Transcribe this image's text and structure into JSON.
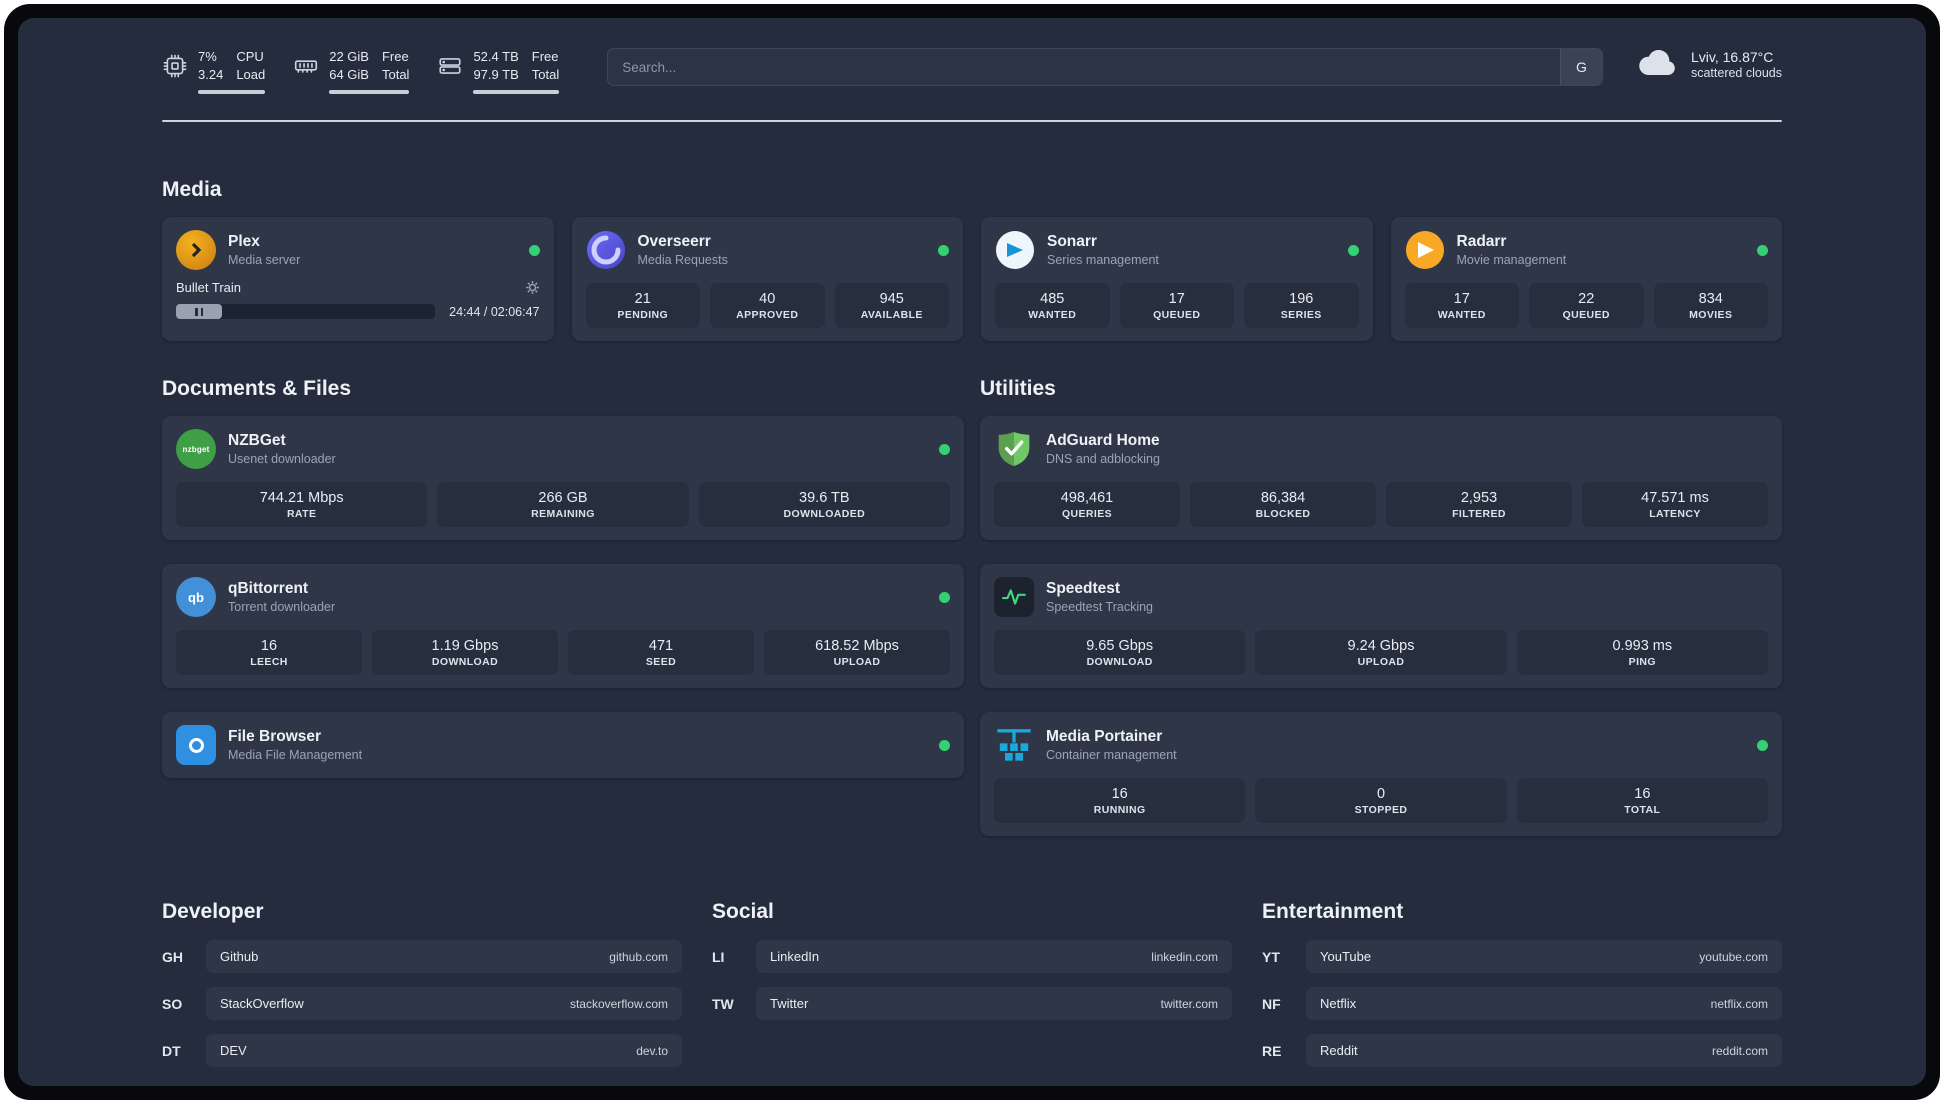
{
  "theme": {
    "background": "#242c3e",
    "card": "#2f3647",
    "stat_tile": "#272e3d",
    "status_online": "#35d073",
    "brand": {
      "plex": "#e5a00d",
      "overseerr": "#5f5cd6",
      "sonarr": "#1794d4",
      "radarr": "#f9a826",
      "nzbget": "#3f9f47",
      "qbittorrent": "#4291d8",
      "filebrowser": "#2f8fe0",
      "adguard": "#67b860",
      "speedtest": "#3fd97c",
      "portainer": "#1aa9dd"
    }
  },
  "topbar": {
    "cpu": {
      "value1": "7%",
      "value2": "3.24",
      "label1": "CPU",
      "label2": "Load"
    },
    "ram": {
      "value1": "22 GiB",
      "value2": "64 GiB",
      "label1": "Free",
      "label2": "Total"
    },
    "disk": {
      "value1": "52.4 TB",
      "value2": "97.9 TB",
      "label1": "Free",
      "label2": "Total"
    },
    "search": {
      "placeholder": "Search...",
      "button_label": "G"
    },
    "weather": {
      "location": "Lviv, 16.87°C",
      "condition": "scattered clouds"
    }
  },
  "sections": {
    "media": "Media",
    "documents": "Documents & Files",
    "utilities": "Utilities",
    "developer": "Developer",
    "social": "Social",
    "entertainment": "Entertainment"
  },
  "apps": {
    "plex": {
      "name": "Plex",
      "desc": "Media server",
      "now_playing": "Bullet Train",
      "time": "24:44 / 02:06:47"
    },
    "overseerr": {
      "name": "Overseerr",
      "desc": "Media Requests",
      "stats": [
        {
          "value": "21",
          "label": "PENDING"
        },
        {
          "value": "40",
          "label": "APPROVED"
        },
        {
          "value": "945",
          "label": "AVAILABLE"
        }
      ]
    },
    "sonarr": {
      "name": "Sonarr",
      "desc": "Series management",
      "stats": [
        {
          "value": "485",
          "label": "WANTED"
        },
        {
          "value": "17",
          "label": "QUEUED"
        },
        {
          "value": "196",
          "label": "SERIES"
        }
      ]
    },
    "radarr": {
      "name": "Radarr",
      "desc": "Movie management",
      "stats": [
        {
          "value": "17",
          "label": "WANTED"
        },
        {
          "value": "22",
          "label": "QUEUED"
        },
        {
          "value": "834",
          "label": "MOVIES"
        }
      ]
    },
    "nzbget": {
      "name": "NZBGet",
      "desc": "Usenet downloader",
      "stats": [
        {
          "value": "744.21 Mbps",
          "label": "RATE"
        },
        {
          "value": "266 GB",
          "label": "REMAINING"
        },
        {
          "value": "39.6 TB",
          "label": "DOWNLOADED"
        }
      ]
    },
    "qbittorrent": {
      "name": "qBittorrent",
      "desc": "Torrent downloader",
      "stats": [
        {
          "value": "16",
          "label": "LEECH"
        },
        {
          "value": "1.19 Gbps",
          "label": "DOWNLOAD"
        },
        {
          "value": "471",
          "label": "SEED"
        },
        {
          "value": "618.52 Mbps",
          "label": "UPLOAD"
        }
      ]
    },
    "filebrowser": {
      "name": "File Browser",
      "desc": "Media File Management"
    },
    "adguard": {
      "name": "AdGuard Home",
      "desc": "DNS and adblocking",
      "stats": [
        {
          "value": "498,461",
          "label": "QUERIES"
        },
        {
          "value": "86,384",
          "label": "BLOCKED"
        },
        {
          "value": "2,953",
          "label": "FILTERED"
        },
        {
          "value": "47.571 ms",
          "label": "LATENCY"
        }
      ]
    },
    "speedtest": {
      "name": "Speedtest",
      "desc": "Speedtest Tracking",
      "stats": [
        {
          "value": "9.65 Gbps",
          "label": "DOWNLOAD"
        },
        {
          "value": "9.24 Gbps",
          "label": "UPLOAD"
        },
        {
          "value": "0.993 ms",
          "label": "PING"
        }
      ]
    },
    "portainer": {
      "name": "Media Portainer",
      "desc": "Container management",
      "stats": [
        {
          "value": "16",
          "label": "RUNNING"
        },
        {
          "value": "0",
          "label": "STOPPED"
        },
        {
          "value": "16",
          "label": "TOTAL"
        }
      ]
    }
  },
  "icons": {
    "nzbget_label": "nzbget",
    "qbittorrent_label": "qb"
  },
  "bookmarks": {
    "developer": [
      {
        "abbr": "GH",
        "name": "Github",
        "url": "github.com"
      },
      {
        "abbr": "SO",
        "name": "StackOverflow",
        "url": "stackoverflow.com"
      },
      {
        "abbr": "DT",
        "name": "DEV",
        "url": "dev.to"
      }
    ],
    "social": [
      {
        "abbr": "LI",
        "name": "LinkedIn",
        "url": "linkedin.com"
      },
      {
        "abbr": "TW",
        "name": "Twitter",
        "url": "twitter.com"
      }
    ],
    "entertainment": [
      {
        "abbr": "YT",
        "name": "YouTube",
        "url": "youtube.com"
      },
      {
        "abbr": "NF",
        "name": "Netflix",
        "url": "netflix.com"
      },
      {
        "abbr": "RE",
        "name": "Reddit",
        "url": "reddit.com"
      }
    ]
  }
}
